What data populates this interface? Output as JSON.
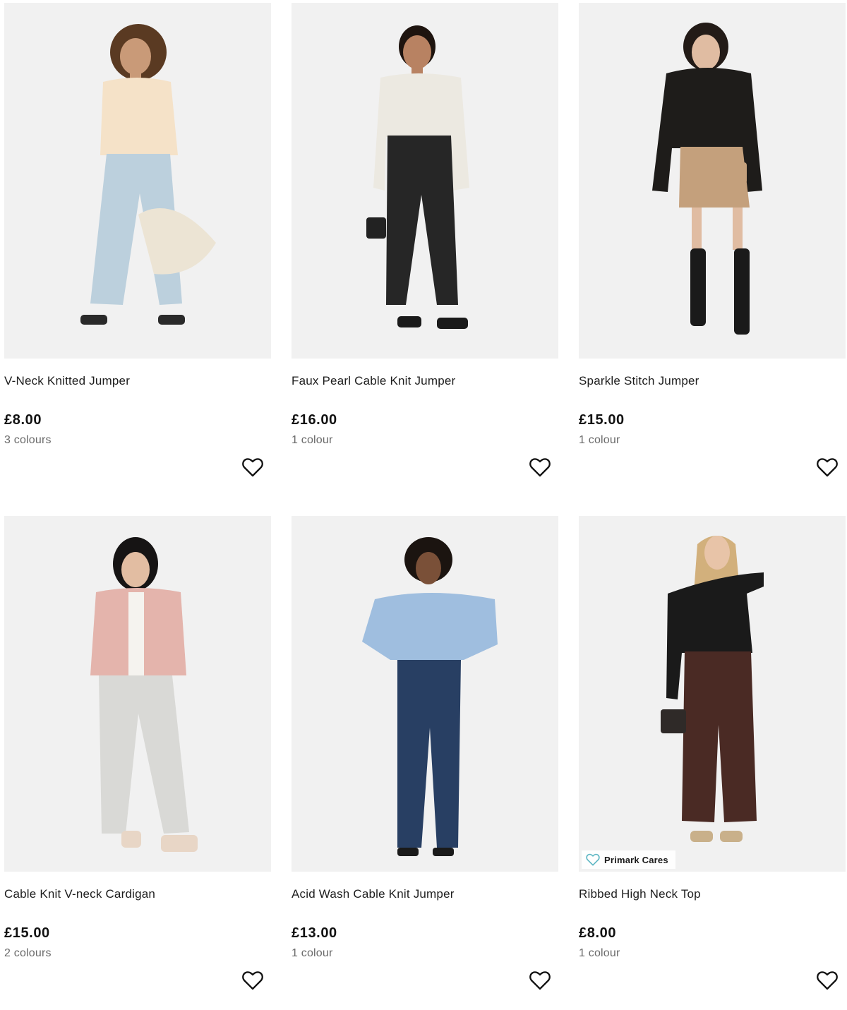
{
  "products": [
    {
      "title": "V-Neck Knitted Jumper",
      "price": "£8.00",
      "colours": "3 colours",
      "image_desc": "model-beige-jumper-light-jeans",
      "colors": {
        "top": "#f5e2c8",
        "bottom": "#bcd0dd",
        "shoe": "#2a2a2a",
        "hair": "#5a3a22",
        "skin": "#c99a78"
      }
    },
    {
      "title": "Faux Pearl Cable Knit Jumper",
      "price": "£16.00",
      "colours": "1 colour",
      "image_desc": "model-cream-cable-jumper-black-trousers",
      "colors": {
        "top": "#ece9e1",
        "bottom": "#262626",
        "shoe": "#1a1a1a",
        "hair": "#1e140f",
        "skin": "#b88262"
      }
    },
    {
      "title": "Sparkle Stitch Jumper",
      "price": "£15.00",
      "colours": "1 colour",
      "image_desc": "model-black-jumper-camel-skirt-boots",
      "colors": {
        "top": "#1e1c1a",
        "bottom": "#c4a07c",
        "shoe": "#1a1a1a",
        "hair": "#231b17",
        "skin": "#e0bca2"
      }
    },
    {
      "title": "Cable Knit V-neck Cardigan",
      "price": "£15.00",
      "colours": "2 colours",
      "image_desc": "model-pink-cardigan-grey-joggers",
      "colors": {
        "top": "#e4b4ac",
        "bottom": "#d9d9d6",
        "shoe": "#e8d6c6",
        "hair": "#161414",
        "skin": "#e2bda2"
      }
    },
    {
      "title": "Acid Wash Cable Knit Jumper",
      "price": "£13.00",
      "colours": "1 colour",
      "image_desc": "model-blue-cable-jumper-dark-jeans",
      "colors": {
        "top": "#9fbedf",
        "bottom": "#283f63",
        "shoe": "#1a1a1a",
        "hair": "#1b1410",
        "skin": "#7a5038"
      }
    },
    {
      "title": "Ribbed High Neck Top",
      "price": "£8.00",
      "colours": "1 colour",
      "image_desc": "model-black-top-brown-trousers",
      "colors": {
        "top": "#1a1a1a",
        "bottom": "#4a2a24",
        "shoe": "#c9b08a",
        "hair": "#d2b07c",
        "skin": "#e8c4a8"
      },
      "badge": "Primark Cares"
    }
  ],
  "icons": {
    "wishlist": "heart-outline-icon",
    "badge": "heart-outline-icon"
  },
  "accent_colors": {
    "badge_heart": "#5fb7c4",
    "photo_bg": "#f1f1f1",
    "text_muted": "#6a6a6a"
  }
}
